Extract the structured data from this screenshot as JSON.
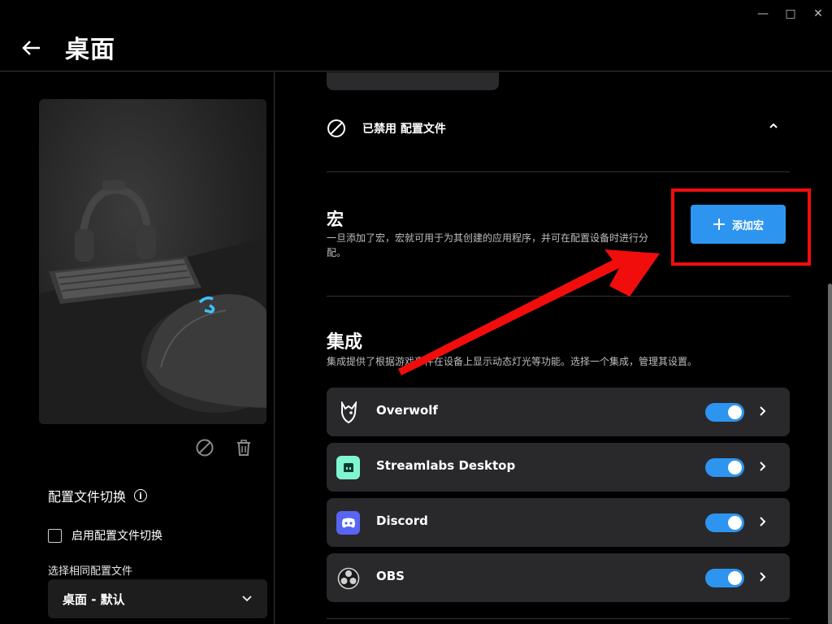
{
  "window": {
    "minimize": "—",
    "maximize": "□",
    "close": "✕"
  },
  "header": {
    "title": "桌面"
  },
  "left": {
    "profile_switch_title": "配置文件切换",
    "enable_switch_label": "启用配置文件切换",
    "same_profile_label": "选择相同配置文件",
    "select_value": "桌面 - 默认"
  },
  "right": {
    "disabled_label": "已禁用 配置文件",
    "macro": {
      "title": "宏",
      "desc": "一旦添加了宏，宏就可用于为其创建的应用程序，并可在配置设备时进行分配。",
      "add_label": "添加宏"
    },
    "integrations": {
      "title": "集成",
      "desc": "集成提供了根据游戏事件在设备上显示动态灯光等功能。选择一个集成，管理其设置。",
      "items": [
        {
          "name": "Overwolf",
          "icon": "overwolf-icon",
          "enabled": true
        },
        {
          "name": "Streamlabs Desktop",
          "icon": "streamlabs-icon",
          "enabled": true
        },
        {
          "name": "Discord",
          "icon": "discord-icon",
          "enabled": true
        },
        {
          "name": "OBS",
          "icon": "obs-icon",
          "enabled": true
        }
      ]
    }
  },
  "colors": {
    "accent": "#2d95f0",
    "highlight": "#f20d0d",
    "card": "#29292b",
    "background": "#000000"
  }
}
